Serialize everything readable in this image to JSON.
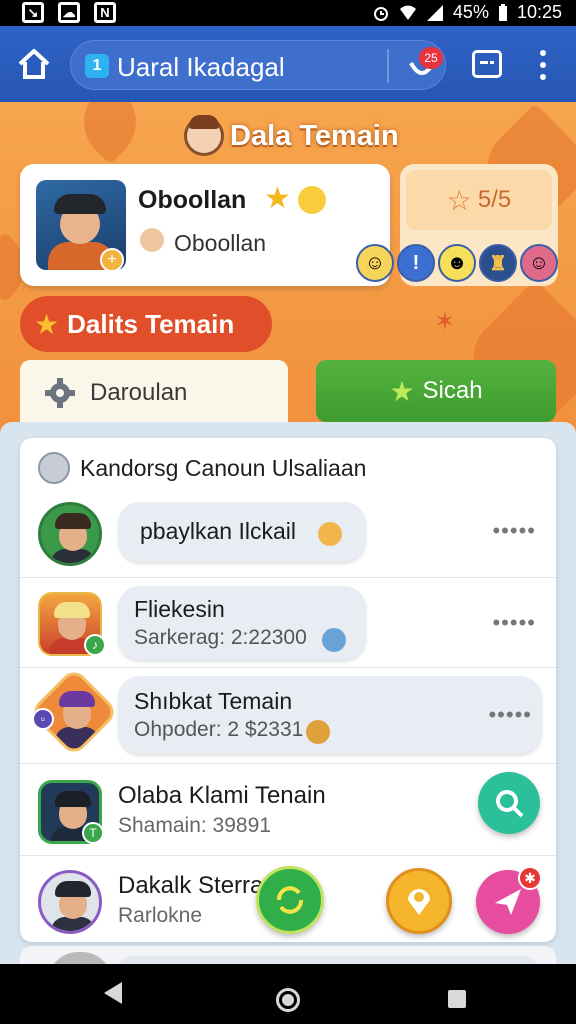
{
  "status_bar": {
    "left_icons": [
      "screenshot-icon",
      "cloud-icon",
      "n-icon"
    ],
    "battery": "45%",
    "time": "10:25"
  },
  "browser": {
    "url_badge": "1",
    "url_text": "Uaral Ikadagal",
    "notification_count": "25"
  },
  "header": {
    "title": "Dala Temain"
  },
  "profile": {
    "name": "Oboollan",
    "subtitle": "Oboollan",
    "rating": "5/5",
    "stickers": [
      "s1",
      "s2",
      "s3",
      "s4",
      "s5"
    ]
  },
  "section": {
    "label": "Dalits Temain"
  },
  "tabs": {
    "left_label": "Daroulan",
    "right_label": "Sicah"
  },
  "list": {
    "header": "Kandorsg Canoun Ulsaliaan",
    "rows": [
      {
        "title": "pbaylkan Ilckail",
        "subtitle": "",
        "more": "•••••"
      },
      {
        "title": "Fliekesin",
        "subtitle": "Sarkerag: 2:22300",
        "more": "•••••"
      },
      {
        "title": "Shıbkat Temain",
        "subtitle": "Ohpoder: 2 $2331",
        "more": "•••••"
      },
      {
        "title": "Olaba Klami Tenain",
        "subtitle": "Shamain: 39891"
      },
      {
        "title": "Dakalk Sterra",
        "subtitle": "Rarlokne"
      }
    ]
  },
  "fabs": {
    "send_badge": "✱"
  },
  "colors": {
    "browser_blue": "#2f62c4",
    "orange_bg": "#f08d3a",
    "section_red": "#e04e2a",
    "tab_green": "#4caf3a"
  }
}
